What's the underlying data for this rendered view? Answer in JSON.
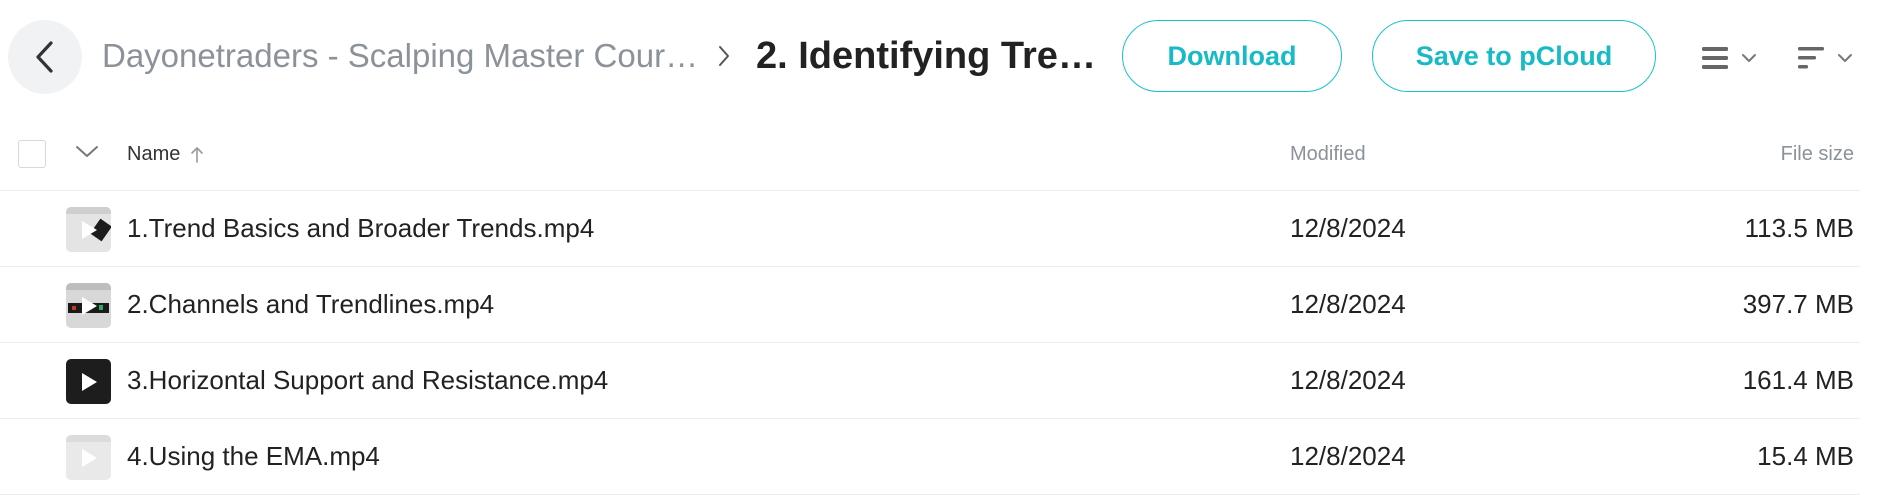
{
  "header": {
    "back_icon": "chevron-left-icon",
    "breadcrumb_parent": "Dayonetraders - Scalping Master Cour…",
    "breadcrumb_separator_icon": "chevron-right-icon",
    "breadcrumb_current": "2. Identifying Tren…",
    "download_label": "Download",
    "save_label": "Save to pCloud",
    "view_toggle_icon": "list-view-icon",
    "sort_toggle_icon": "sort-icon"
  },
  "list_header": {
    "name_label": "Name",
    "name_sort_icon": "arrow-up-icon",
    "modified_label": "Modified",
    "size_label": "File size"
  },
  "files": [
    {
      "name": "1.Trend Basics and Broader Trends.mp4",
      "modified": "12/8/2024",
      "size": "113.5 MB",
      "thumb": "light"
    },
    {
      "name": "2.Channels and Trendlines.mp4",
      "modified": "12/8/2024",
      "size": "397.7 MB",
      "thumb": "chart"
    },
    {
      "name": "3.Horizontal Support and Resistance.mp4",
      "modified": "12/8/2024",
      "size": "161.4 MB",
      "thumb": "dark"
    },
    {
      "name": "4.Using the EMA.mp4",
      "modified": "12/8/2024",
      "size": "15.4 MB",
      "thumb": "faded"
    }
  ],
  "colors": {
    "accent": "#17bac5",
    "muted_text": "#8b929a",
    "divider": "#ececec"
  }
}
